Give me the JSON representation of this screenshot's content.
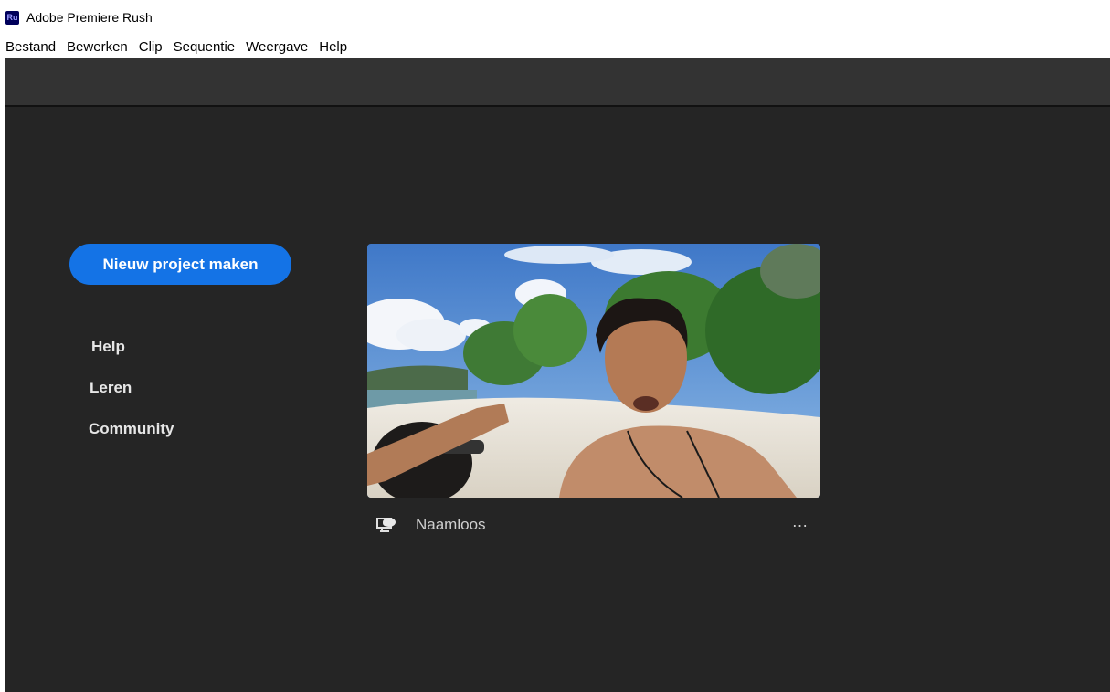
{
  "window": {
    "logo_text": "Ru",
    "title": "Adobe Premiere Rush"
  },
  "menu": [
    "Bestand",
    "Bewerken",
    "Clip",
    "Sequentie",
    "Weergave",
    "Help"
  ],
  "home": {
    "new_project_label": "Nieuw project maken",
    "links": [
      "Help",
      "Leren",
      "Community"
    ]
  },
  "project": {
    "name": "Naamloos",
    "more_icon": "…",
    "sync_icon": "cloud-sync-icon"
  },
  "colors": {
    "accent": "#1473e6",
    "background": "#252525",
    "toolbar": "#333333"
  }
}
